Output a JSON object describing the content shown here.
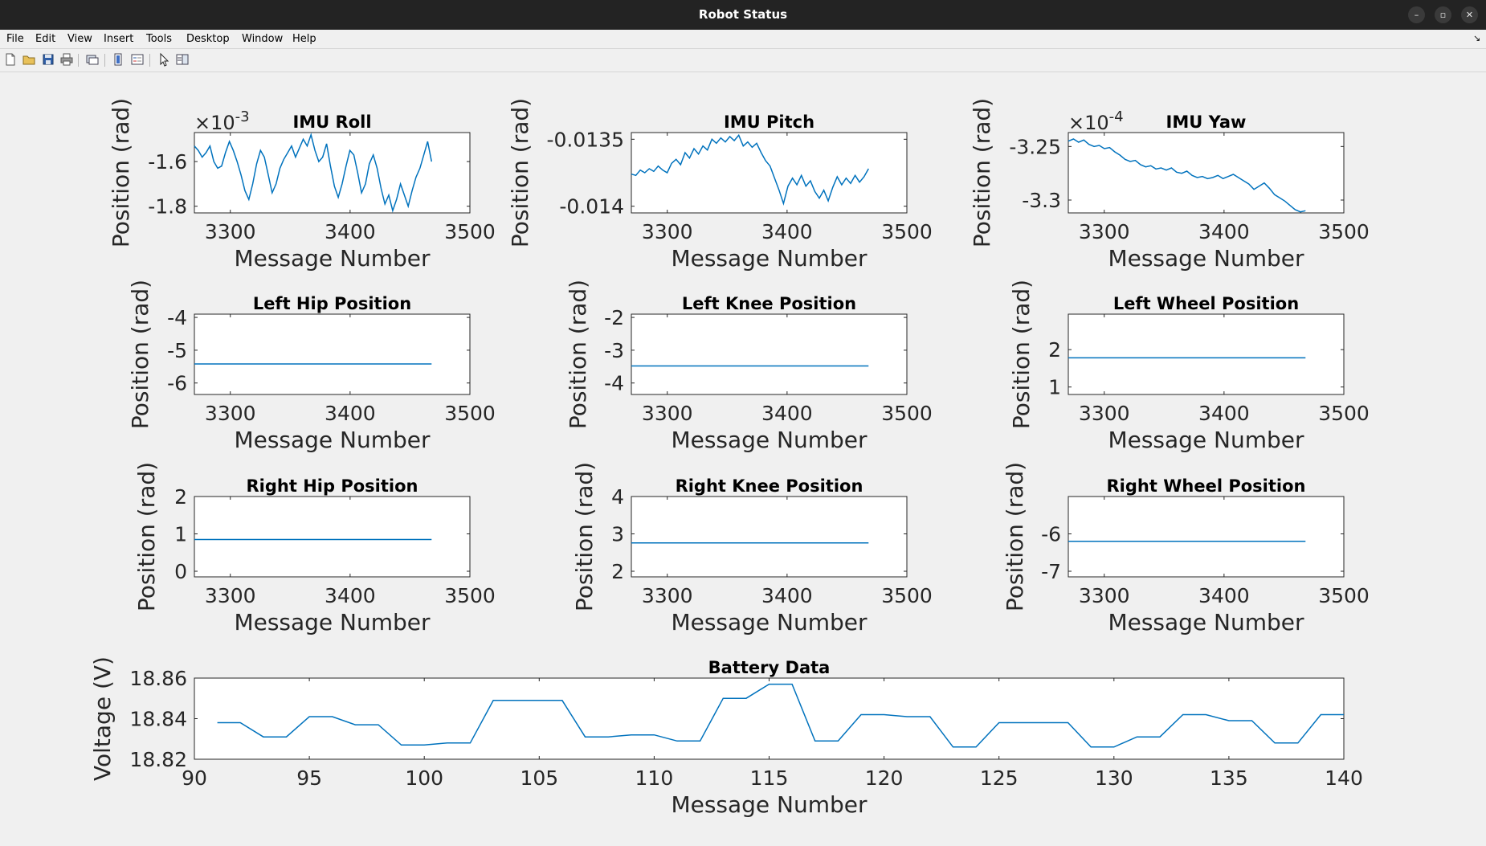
{
  "window": {
    "title": "Robot Status",
    "controls": {
      "minimize": "–",
      "maximize": "▫",
      "close": "✕"
    }
  },
  "menu": {
    "items": [
      {
        "id": "file",
        "label": "File"
      },
      {
        "id": "edit",
        "label": "Edit"
      },
      {
        "id": "view",
        "label": "View"
      },
      {
        "id": "insert",
        "label": "Insert"
      },
      {
        "id": "tools",
        "label": "Tools"
      },
      {
        "id": "desktop",
        "label": "Desktop"
      },
      {
        "id": "window",
        "label": "Window"
      },
      {
        "id": "help",
        "label": "Help"
      }
    ],
    "undock_glyph": "↘"
  },
  "toolbar": {
    "icons": [
      "new-figure-icon",
      "open-file-icon",
      "save-icon",
      "print-icon",
      "link-icon",
      "colorbar-icon",
      "legend-icon",
      "pointer-icon",
      "property-editor-icon"
    ]
  },
  "colors": {
    "line": "#0072bd",
    "axes_bg": "#ffffff",
    "figure_bg": "#f0f0f0",
    "titlebar": "#232323"
  },
  "chart_data": [
    {
      "id": "imu-roll",
      "type": "line",
      "title": "IMU Roll",
      "xlabel": "Message Number",
      "ylabel": "Position (rad)",
      "xlim": [
        3270,
        3500
      ],
      "ylim": [
        -1.83,
        -1.47
      ],
      "xticks": [
        3300,
        3400,
        3500
      ],
      "xtick_labels": [
        "3300",
        "3400",
        "3500"
      ],
      "yticks": [
        -1.6,
        -1.8
      ],
      "ytick_labels": [
        "-1.6",
        "-1.8"
      ],
      "exponent": "-3",
      "series": [
        {
          "x_start": 3270,
          "x_end": 3468,
          "y": [
            -1.53,
            -1.55,
            -1.58,
            -1.56,
            -1.53,
            -1.6,
            -1.63,
            -1.62,
            -1.56,
            -1.51,
            -1.55,
            -1.6,
            -1.66,
            -1.73,
            -1.77,
            -1.7,
            -1.61,
            -1.55,
            -1.58,
            -1.66,
            -1.74,
            -1.7,
            -1.63,
            -1.59,
            -1.56,
            -1.53,
            -1.58,
            -1.54,
            -1.5,
            -1.53,
            -1.48,
            -1.55,
            -1.6,
            -1.58,
            -1.52,
            -1.62,
            -1.71,
            -1.76,
            -1.7,
            -1.62,
            -1.55,
            -1.57,
            -1.65,
            -1.74,
            -1.7,
            -1.61,
            -1.57,
            -1.63,
            -1.72,
            -1.79,
            -1.75,
            -1.82,
            -1.77,
            -1.7,
            -1.75,
            -1.8,
            -1.73,
            -1.67,
            -1.63,
            -1.57,
            -1.51,
            -1.6
          ]
        }
      ]
    },
    {
      "id": "imu-pitch",
      "type": "line",
      "title": "IMU Pitch",
      "xlabel": "Message Number",
      "ylabel": "Position (rad)",
      "xlim": [
        3270,
        3500
      ],
      "ylim": [
        -0.01405,
        -0.01345
      ],
      "xticks": [
        3300,
        3400,
        3500
      ],
      "xtick_labels": [
        "3300",
        "3400",
        "3500"
      ],
      "yticks": [
        -0.0135,
        -0.014
      ],
      "ytick_labels": [
        "-0.0135",
        "-0.014"
      ],
      "series": [
        {
          "x_start": 3270,
          "x_end": 3468,
          "y": [
            -0.01376,
            -0.01377,
            -0.01373,
            -0.01375,
            -0.01372,
            -0.01374,
            -0.0137,
            -0.01373,
            -0.01375,
            -0.01368,
            -0.01365,
            -0.01369,
            -0.0136,
            -0.01364,
            -0.01357,
            -0.01361,
            -0.01355,
            -0.01358,
            -0.0135,
            -0.01353,
            -0.01349,
            -0.01352,
            -0.01348,
            -0.01351,
            -0.01347,
            -0.01355,
            -0.01352,
            -0.01356,
            -0.01353,
            -0.0136,
            -0.01366,
            -0.0137,
            -0.01379,
            -0.01388,
            -0.01398,
            -0.01385,
            -0.01379,
            -0.01384,
            -0.01377,
            -0.01385,
            -0.01381,
            -0.01389,
            -0.01394,
            -0.01388,
            -0.01396,
            -0.01386,
            -0.01378,
            -0.01384,
            -0.01379,
            -0.01383,
            -0.01377,
            -0.01382,
            -0.01378,
            -0.01372
          ]
        }
      ]
    },
    {
      "id": "imu-yaw",
      "type": "line",
      "title": "IMU Yaw",
      "xlabel": "Message Number",
      "ylabel": "Position (rad)",
      "xlim": [
        3270,
        3500
      ],
      "ylim": [
        -3.312,
        -3.237
      ],
      "xticks": [
        3300,
        3400,
        3500
      ],
      "xtick_labels": [
        "3300",
        "3400",
        "3500"
      ],
      "yticks": [
        -3.25,
        -3.3
      ],
      "ytick_labels": [
        "-3.25",
        "-3.3"
      ],
      "exponent": "-4",
      "series": [
        {
          "x_start": 3270,
          "x_end": 3468,
          "y": [
            -3.245,
            -3.243,
            -3.246,
            -3.244,
            -3.248,
            -3.25,
            -3.249,
            -3.252,
            -3.251,
            -3.255,
            -3.258,
            -3.262,
            -3.264,
            -3.263,
            -3.267,
            -3.269,
            -3.268,
            -3.271,
            -3.27,
            -3.272,
            -3.27,
            -3.274,
            -3.275,
            -3.273,
            -3.277,
            -3.279,
            -3.278,
            -3.28,
            -3.279,
            -3.277,
            -3.28,
            -3.278,
            -3.276,
            -3.279,
            -3.282,
            -3.285,
            -3.29,
            -3.287,
            -3.284,
            -3.289,
            -3.295,
            -3.298,
            -3.301,
            -3.305,
            -3.309,
            -3.311,
            -3.31
          ]
        }
      ]
    },
    {
      "id": "left-hip",
      "type": "line",
      "title": "Left Hip Position",
      "xlabel": "Message Number",
      "ylabel": "Position (rad)",
      "xlim": [
        3270,
        3500
      ],
      "ylim": [
        -6.35,
        -3.9
      ],
      "xticks": [
        3300,
        3400,
        3500
      ],
      "xtick_labels": [
        "3300",
        "3400",
        "3500"
      ],
      "yticks": [
        -4,
        -5,
        -6
      ],
      "ytick_labels": [
        "-4",
        "-5",
        "-6"
      ],
      "series": [
        {
          "x_start": 3270,
          "x_end": 3468,
          "y": [
            -5.42,
            -5.42
          ]
        }
      ]
    },
    {
      "id": "left-knee",
      "type": "line",
      "title": "Left Knee Position",
      "xlabel": "Message Number",
      "ylabel": "Position (rad)",
      "xlim": [
        3270,
        3500
      ],
      "ylim": [
        -4.35,
        -1.9
      ],
      "xticks": [
        3300,
        3400,
        3500
      ],
      "xtick_labels": [
        "3300",
        "3400",
        "3500"
      ],
      "yticks": [
        -2,
        -3,
        -4
      ],
      "ytick_labels": [
        "-2",
        "-3",
        "-4"
      ],
      "series": [
        {
          "x_start": 3270,
          "x_end": 3468,
          "y": [
            -3.48,
            -3.48
          ]
        }
      ]
    },
    {
      "id": "left-wheel",
      "type": "line",
      "title": "Left Wheel Position",
      "xlabel": "Message Number",
      "ylabel": "Position (rad)",
      "xlim": [
        3270,
        3500
      ],
      "ylim": [
        0.8,
        2.95
      ],
      "xticks": [
        3300,
        3400,
        3500
      ],
      "xtick_labels": [
        "3300",
        "3400",
        "3500"
      ],
      "yticks": [
        2,
        1
      ],
      "ytick_labels": [
        "2",
        "1"
      ],
      "series": [
        {
          "x_start": 3270,
          "x_end": 3468,
          "y": [
            1.78,
            1.78
          ]
        }
      ]
    },
    {
      "id": "right-hip",
      "type": "line",
      "title": "Right Hip Position",
      "xlabel": "Message Number",
      "ylabel": "Position (rad)",
      "xlim": [
        3270,
        3500
      ],
      "ylim": [
        -0.15,
        2.0
      ],
      "xticks": [
        3300,
        3400,
        3500
      ],
      "xtick_labels": [
        "3300",
        "3400",
        "3500"
      ],
      "yticks": [
        2,
        1,
        0
      ],
      "ytick_labels": [
        "2",
        "1",
        "0"
      ],
      "series": [
        {
          "x_start": 3270,
          "x_end": 3468,
          "y": [
            0.85,
            0.85
          ]
        }
      ]
    },
    {
      "id": "right-knee",
      "type": "line",
      "title": "Right Knee Position",
      "xlabel": "Message Number",
      "ylabel": "Position (rad)",
      "xlim": [
        3270,
        3500
      ],
      "ylim": [
        1.85,
        4.0
      ],
      "xticks": [
        3300,
        3400,
        3500
      ],
      "xtick_labels": [
        "3300",
        "3400",
        "3500"
      ],
      "yticks": [
        4,
        3,
        2
      ],
      "ytick_labels": [
        "4",
        "3",
        "2"
      ],
      "series": [
        {
          "x_start": 3270,
          "x_end": 3468,
          "y": [
            2.76,
            2.76
          ]
        }
      ]
    },
    {
      "id": "right-wheel",
      "type": "line",
      "title": "Right Wheel Position",
      "xlabel": "Message Number",
      "ylabel": "Position (rad)",
      "xlim": [
        3270,
        3500
      ],
      "ylim": [
        -7.15,
        -5.0
      ],
      "xticks": [
        3300,
        3400,
        3500
      ],
      "xtick_labels": [
        "3300",
        "3400",
        "3500"
      ],
      "yticks": [
        -6,
        -7
      ],
      "ytick_labels": [
        "-6",
        "-7"
      ],
      "series": [
        {
          "x_start": 3270,
          "x_end": 3468,
          "y": [
            -6.2,
            -6.2
          ]
        }
      ]
    },
    {
      "id": "battery",
      "type": "line",
      "title": "Battery Data",
      "xlabel": "Message Number",
      "ylabel": "Voltage (V)",
      "xlim": [
        90,
        140
      ],
      "ylim": [
        18.82,
        18.86
      ],
      "xticks": [
        90,
        95,
        100,
        105,
        110,
        115,
        120,
        125,
        130,
        135,
        140
      ],
      "xtick_labels": [
        "90",
        "95",
        "100",
        "105",
        "110",
        "115",
        "120",
        "125",
        "130",
        "135",
        "140"
      ],
      "yticks": [
        18.86,
        18.84,
        18.82
      ],
      "ytick_labels": [
        "18.86",
        "18.84",
        "18.82"
      ],
      "series": [
        {
          "x": [
            91,
            92,
            93,
            94,
            95,
            96,
            97,
            98,
            99,
            100,
            101,
            102,
            103,
            104,
            105,
            106,
            107,
            108,
            109,
            110,
            111,
            112,
            113,
            114,
            115,
            116,
            117,
            118,
            119,
            120,
            121,
            122,
            123,
            124,
            125,
            126,
            127,
            128,
            129,
            130,
            131,
            132,
            133,
            134,
            135,
            136,
            137,
            138,
            139,
            140
          ],
          "y": [
            18.838,
            18.838,
            18.831,
            18.831,
            18.841,
            18.841,
            18.837,
            18.837,
            18.827,
            18.827,
            18.828,
            18.828,
            18.849,
            18.849,
            18.849,
            18.849,
            18.831,
            18.831,
            18.832,
            18.832,
            18.829,
            18.829,
            18.85,
            18.85,
            18.857,
            18.857,
            18.829,
            18.829,
            18.842,
            18.842,
            18.841,
            18.841,
            18.826,
            18.826,
            18.838,
            18.838,
            18.838,
            18.838,
            18.826,
            18.826,
            18.831,
            18.831,
            18.842,
            18.842,
            18.839,
            18.839,
            18.828,
            18.828,
            18.842,
            18.842
          ]
        }
      ]
    }
  ]
}
